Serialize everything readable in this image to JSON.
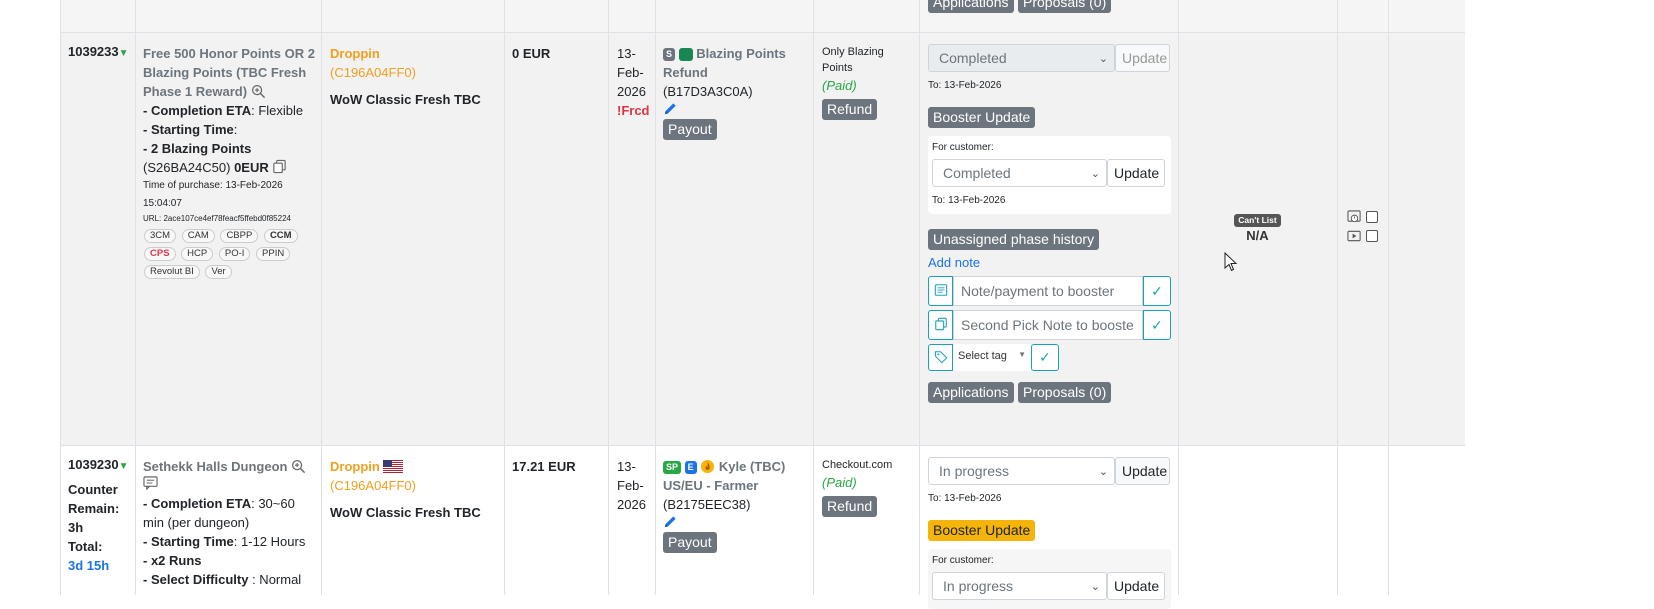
{
  "top_row": {
    "applications_label": "Applications",
    "proposals_label": "Proposals (0)"
  },
  "order1": {
    "id": "1039233",
    "title": [
      "Free 500 Honor Points OR 2",
      "Blazing Points (TBC Fresh",
      "Phase 1 Reward)"
    ],
    "eta_label": "- Completion ETA",
    "eta_value": ": Flexible",
    "start_label": "- Starting Time",
    "start_value": ":",
    "points_label": "- 2 Blazing Points",
    "code": "(S26BA24C50)",
    "price_small": "0EUR",
    "purchase_time": [
      "Time of purchase: 13-Feb-2026",
      "15:04:07"
    ],
    "url": "URL: 2ace107ce4ef78feacf5ffebd0f85224",
    "tags": [
      "3CM",
      "CAM",
      "CBPP",
      "CCM",
      "CPS",
      "HCP",
      "PO-I",
      "PPIN",
      "Revolut BI",
      "Ver"
    ],
    "customer": "Droppin",
    "customer_code": "(C196A04FF0)",
    "game": "WoW Classic Fresh TBC",
    "price": "0 EUR",
    "date": [
      "13-",
      "Feb-",
      "2026"
    ],
    "forced": "!Frcd",
    "booster_badge_s": "S",
    "booster_name": [
      "Blazing Points",
      "Refund"
    ],
    "booster_code": "(B17D3A3C0A)",
    "payout_label": "Payout",
    "payment_method": "Only Blazing Points",
    "payment_status": "(Paid)",
    "refund_label": "Refund",
    "status_select": "Completed",
    "update_label": "Update",
    "to_date": "To: 13-Feb-2026",
    "booster_update_label": "Booster Update",
    "for_customer_label": "For customer:",
    "customer_status": "Completed",
    "customer_update_label": "Update",
    "customer_to_date": "To: 13-Feb-2026",
    "phase_history_label": "Unassigned phase history",
    "add_note_label": "Add note",
    "note_placeholder": "Note/payment to booster",
    "second_note_placeholder": "Second Pick Note to booste",
    "select_tag_label": "Select tag",
    "applications_label": "Applications",
    "proposals_label": "Proposals (0)",
    "cant_list_label": "Can't List",
    "na_label": "N/A"
  },
  "order2": {
    "id": "1039230",
    "counter": [
      "Counter",
      "Remain:",
      "3h",
      "Total:"
    ],
    "total_value": "3d 15h",
    "title": "Sethekk Halls Dungeon",
    "eta_label": "- Completion ETA",
    "eta_value": ": 30~60",
    "eta_value2": "min (per dungeon)",
    "start_label": "- Starting Time",
    "start_value": ": 1-12 Hours",
    "runs_label": "- x2 Runs",
    "difficulty_label": "- Select Difficulty",
    "difficulty_value": " : Normal",
    "customer": "Droppin",
    "customer_code": "(C196A04FF0)",
    "game": "WoW Classic Fresh TBC",
    "price": "17.21 EUR",
    "date": [
      "13-",
      "Feb-",
      "2026"
    ],
    "badge_sp": "SP",
    "badge_e": "E",
    "booster_name": [
      "Kyle (TBC)",
      "US/EU - Farmer"
    ],
    "booster_code": "(B2175EEC38)",
    "payout_label": "Payout",
    "payment_method": "Checkout.com",
    "payment_status": "(Paid)",
    "refund_label": "Refund",
    "status_select": "In progress",
    "update_label": "Update",
    "to_date": "To: 13-Feb-2026",
    "booster_update_label": "Booster Update",
    "for_customer_label": "For customer:",
    "customer_status": "In progress",
    "customer_update_label": "Update"
  },
  "colors": {
    "accent_orange": "#f0a020",
    "green": "#28a745",
    "red": "#dc3545",
    "teal": "#17a2b8",
    "link_blue": "#1a73e8"
  }
}
